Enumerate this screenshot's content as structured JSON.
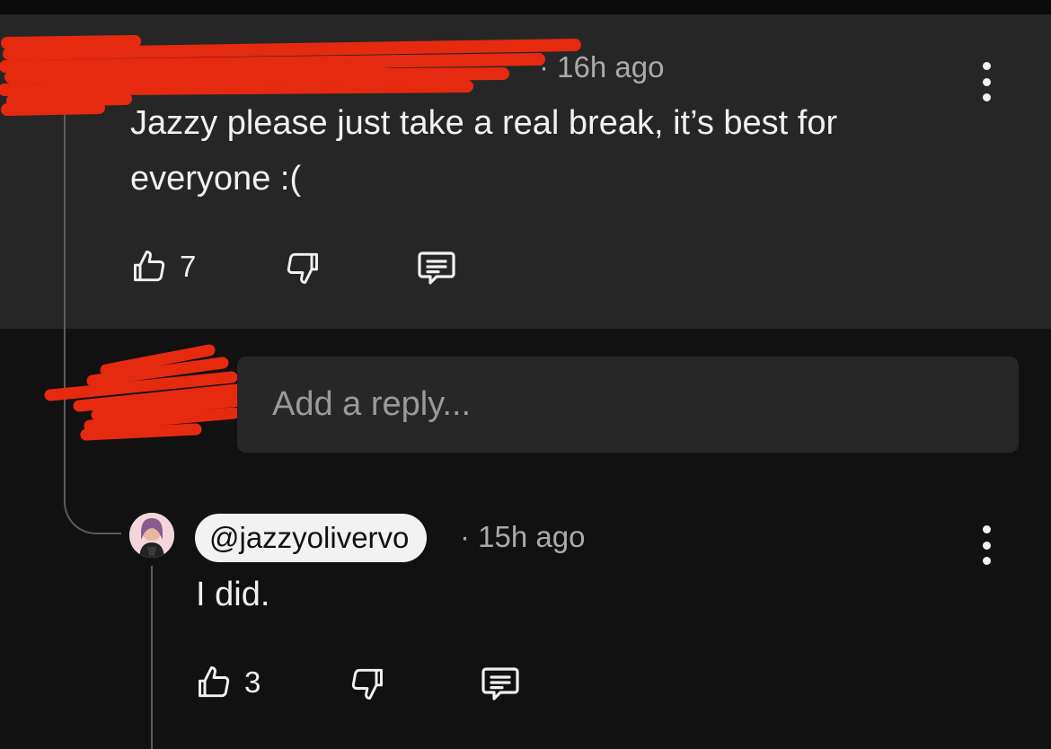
{
  "parent_comment": {
    "timestamp": "16h ago",
    "text": "Jazzy please just take a real break, it’s best for everyone :(",
    "like_count": "7"
  },
  "reply_box": {
    "placeholder": "Add a reply..."
  },
  "reply_comment": {
    "handle": "@jazzyolivervo",
    "timestamp": "15h ago",
    "text": "I did.",
    "like_count": "3"
  },
  "icons": {
    "like": "thumbs-up-icon",
    "dislike": "thumbs-down-icon",
    "reply": "comment-icon",
    "menu": "more-vertical-icon"
  },
  "colors": {
    "background": "#111111",
    "highlight_background": "#262626",
    "redaction": "#e62a0f"
  }
}
